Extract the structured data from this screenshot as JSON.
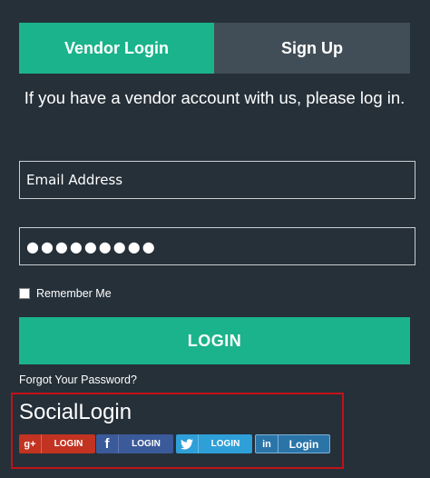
{
  "tabs": {
    "login": "Vendor Login",
    "signup": "Sign Up"
  },
  "intro": "If you have a vendor account with us, please log in.",
  "form": {
    "email_placeholder": "Email Address",
    "password_value": "●●●●●●●●●",
    "remember_label": "Remember Me",
    "login_button": "LOGIN",
    "forgot_link": "Forgot Your Password?"
  },
  "social": {
    "title": "SocialLogin",
    "buttons": [
      {
        "icon": "google-plus-icon",
        "glyph": "g+",
        "label": "LOGIN",
        "color": "#c23321"
      },
      {
        "icon": "facebook-icon",
        "glyph": "f",
        "label": "LOGIN",
        "color": "#3b5a9a"
      },
      {
        "icon": "twitter-icon",
        "glyph": "",
        "label": "LOGIN",
        "color": "#2f9fd8"
      },
      {
        "icon": "linkedin-icon",
        "glyph": "in",
        "label": "Login",
        "color": "#2a74a8"
      }
    ]
  },
  "colors": {
    "accent": "#1bb38b",
    "background": "#253039",
    "highlight_border": "#c1121a"
  }
}
